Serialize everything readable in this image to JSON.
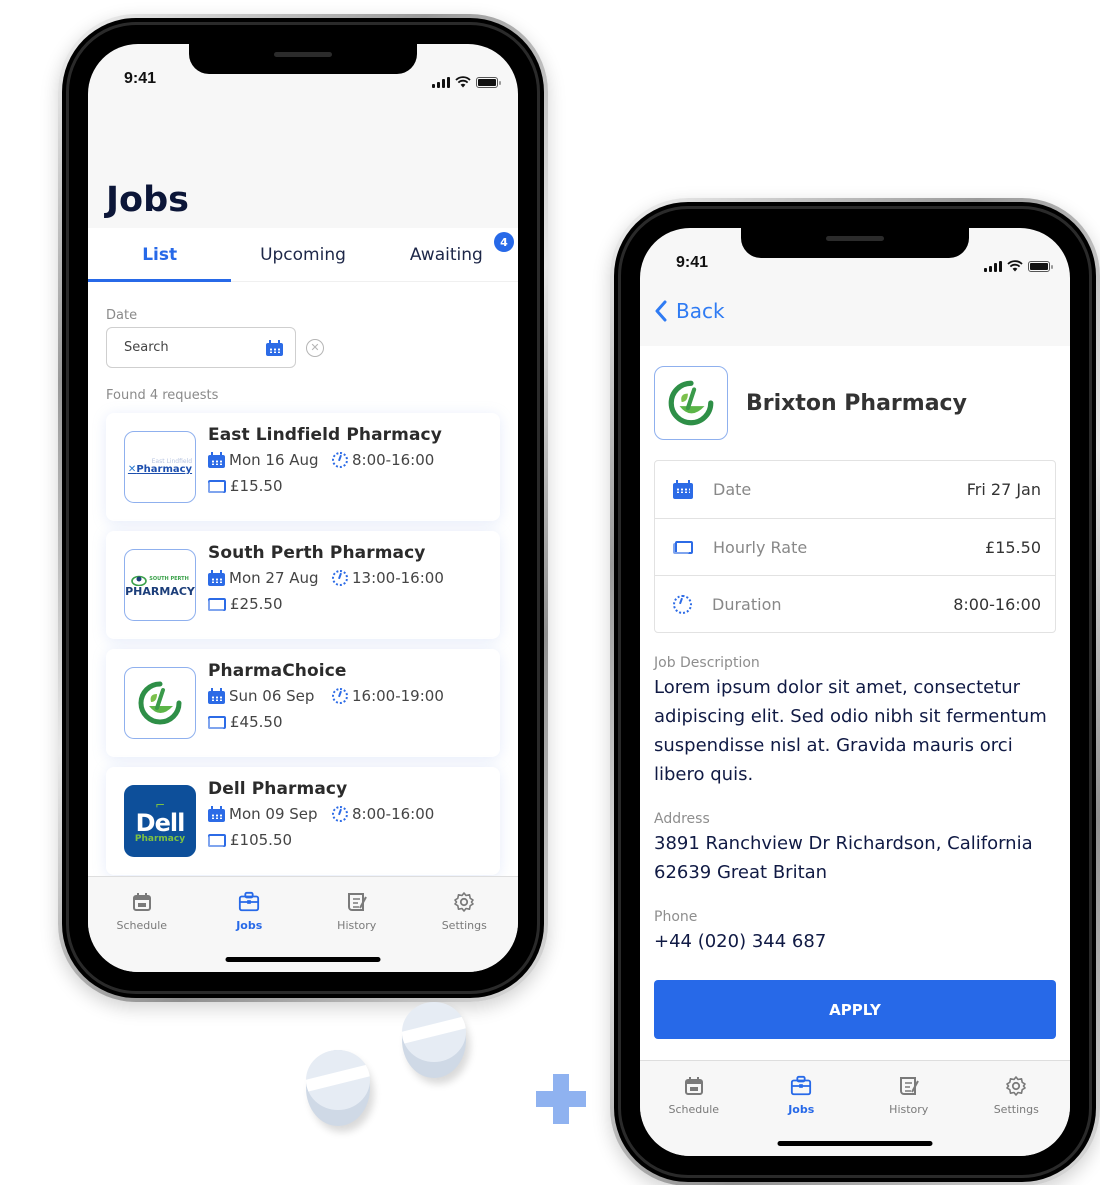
{
  "colors": {
    "accent": "#2769e8",
    "back_link": "#2f7bf3",
    "title": "#0c1638",
    "muted": "#8a8a8a"
  },
  "status_bar": {
    "time": "9:41"
  },
  "list_screen": {
    "title": "Jobs",
    "tabs": [
      {
        "label": "List",
        "active": true
      },
      {
        "label": "Upcoming",
        "active": false
      },
      {
        "label": "Awaiting",
        "active": false,
        "badge": "4"
      }
    ],
    "date_filter": {
      "label": "Date",
      "placeholder": "Search",
      "icon": "calendar-icon",
      "clear_icon": "clear-circle-icon"
    },
    "found_text": "Found 4 requests",
    "jobs": [
      {
        "name": "East Lindfield Pharmacy",
        "date": "Mon 16 Aug",
        "time": "8:00-16:00",
        "rate": "£15.50",
        "logo_text": "Pharmacy",
        "logo_sub": "East Lindfield"
      },
      {
        "name": "South Perth Pharmacy",
        "date": "Mon 27 Aug",
        "time": "13:00-16:00",
        "rate": "£25.50",
        "logo_text": "PHARMACY",
        "logo_sub": "SOUTH PERTH"
      },
      {
        "name": "PharmaChoice",
        "date": "Sun 06 Sep",
        "time": "16:00-19:00",
        "rate": "£45.50"
      },
      {
        "name": "Dell Pharmacy",
        "date": "Mon 09 Sep",
        "time": "8:00-16:00",
        "rate": "£105.50",
        "logo_text": "Dell",
        "logo_sub": "Pharmacy"
      }
    ]
  },
  "detail_screen": {
    "back_label": "Back",
    "pharmacy_name": "Brixton Pharmacy",
    "info_rows": [
      {
        "label": "Date",
        "value": "Fri 27 Jan",
        "icon": "calendar-icon"
      },
      {
        "label": "Hourly Rate",
        "value": "£15.50",
        "icon": "cash-icon"
      },
      {
        "label": "Duration",
        "value": "8:00-16:00",
        "icon": "clock-icon"
      }
    ],
    "description_label": "Job Description",
    "description": "Lorem ipsum dolor sit amet, consectetur adipiscing elit. Sed odio nibh sit fermentum suspendisse nisl at. Gravida mauris orci libero quis.",
    "address_label": "Address",
    "address": "3891 Ranchview Dr Richardson, California 62639 Great Britan",
    "phone_label": "Phone",
    "phone": "+44 (020) 344 687",
    "apply_label": "APPLY"
  },
  "tabbar": {
    "items": [
      {
        "label": "Schedule",
        "icon": "calendar-icon",
        "active": false
      },
      {
        "label": "Jobs",
        "icon": "briefcase-icon",
        "active": true
      },
      {
        "label": "History",
        "icon": "history-scroll-icon",
        "active": false
      },
      {
        "label": "Settings",
        "icon": "gear-icon",
        "active": false
      }
    ]
  }
}
